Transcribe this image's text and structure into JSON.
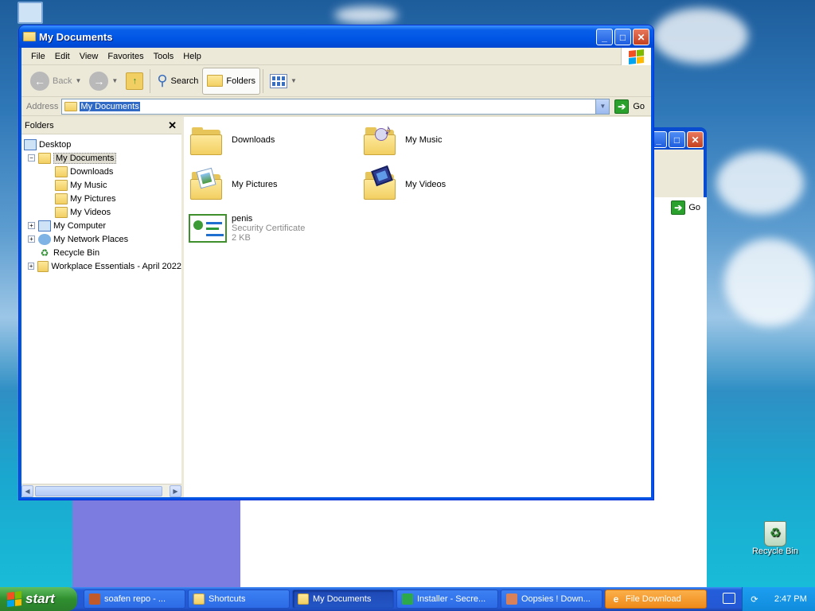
{
  "desktop": {
    "recycle_bin_label": "Recycle Bin"
  },
  "window": {
    "title": "My Documents",
    "menu": [
      "File",
      "Edit",
      "View",
      "Favorites",
      "Tools",
      "Help"
    ],
    "toolbar": {
      "back": "Back",
      "search": "Search",
      "folders": "Folders"
    },
    "address": {
      "label": "Address",
      "value": "My Documents",
      "go": "Go"
    },
    "folders_pane": {
      "title": "Folders",
      "tree": [
        {
          "label": "Desktop"
        },
        {
          "label": "My Documents"
        },
        {
          "label": "Downloads"
        },
        {
          "label": "My Music"
        },
        {
          "label": "My Pictures"
        },
        {
          "label": "My Videos"
        },
        {
          "label": "My Computer"
        },
        {
          "label": "My Network Places"
        },
        {
          "label": "Recycle Bin"
        },
        {
          "label": "Workplace Essentials - April 2022"
        }
      ]
    },
    "items": [
      {
        "name": "Downloads"
      },
      {
        "name": "My Music"
      },
      {
        "name": "My Pictures"
      },
      {
        "name": "My Videos"
      },
      {
        "name": "penis",
        "type": "Security Certificate",
        "size": "2 KB"
      }
    ]
  },
  "background_window": {
    "go": "Go"
  },
  "taskbar": {
    "start": "start",
    "tasks": [
      {
        "label": "soafen repo - ..."
      },
      {
        "label": "Shortcuts"
      },
      {
        "label": "My Documents"
      },
      {
        "label": "Installer - Secre..."
      },
      {
        "label": "Oopsies ! Down..."
      },
      {
        "label": "File Download"
      }
    ],
    "clock": "2:47 PM"
  },
  "colors": {
    "title_blue": "#0054e3",
    "start_green": "#2f8f2f",
    "flash_orange": "#ef8a1a",
    "selection": "#316ac5"
  }
}
